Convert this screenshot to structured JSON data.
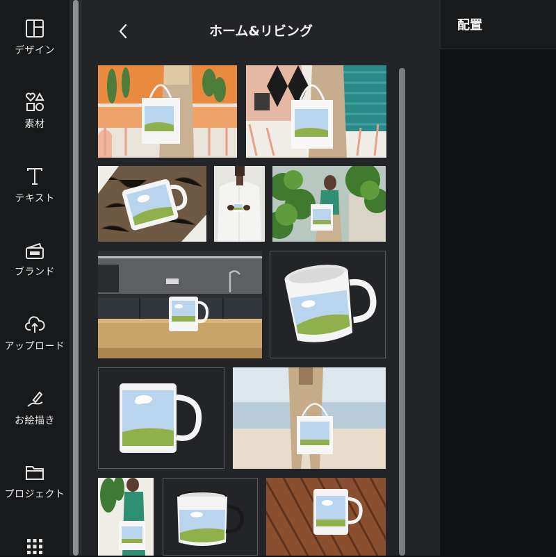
{
  "sidebar": {
    "items": [
      {
        "label": "デザイン",
        "icon": "layout-icon"
      },
      {
        "label": "素材",
        "icon": "shapes-icon"
      },
      {
        "label": "テキスト",
        "icon": "text-icon"
      },
      {
        "label": "ブランド",
        "icon": "brand-icon"
      },
      {
        "label": "アップロード",
        "icon": "upload-cloud-icon"
      },
      {
        "label": "お絵描き",
        "icon": "draw-pen-icon"
      },
      {
        "label": "プロジェクト",
        "icon": "folder-icon"
      },
      {
        "label": "",
        "icon": "apps-grid-icon"
      }
    ]
  },
  "panel": {
    "title": "ホーム&リビング",
    "back_icon": "chevron-left-icon",
    "thumbnails": [
      "tote-bag-on-terrace",
      "tote-bag-striped-wall",
      "mug-in-gift-box",
      "person-holding-mug",
      "tote-bag-in-garden",
      "mug-on-kitchen-counter",
      "mug-tilted",
      "mug-front",
      "tote-bag-at-beach",
      "tote-bag-with-plants",
      "enamel-mug",
      "mug-on-wooden-table"
    ]
  },
  "right_panel": {
    "title": "配置"
  },
  "colors": {
    "sidebar_bg": "#18191b",
    "panel_bg": "#232427",
    "canvas_bg": "#0f1115",
    "text": "#e6e6e6"
  }
}
